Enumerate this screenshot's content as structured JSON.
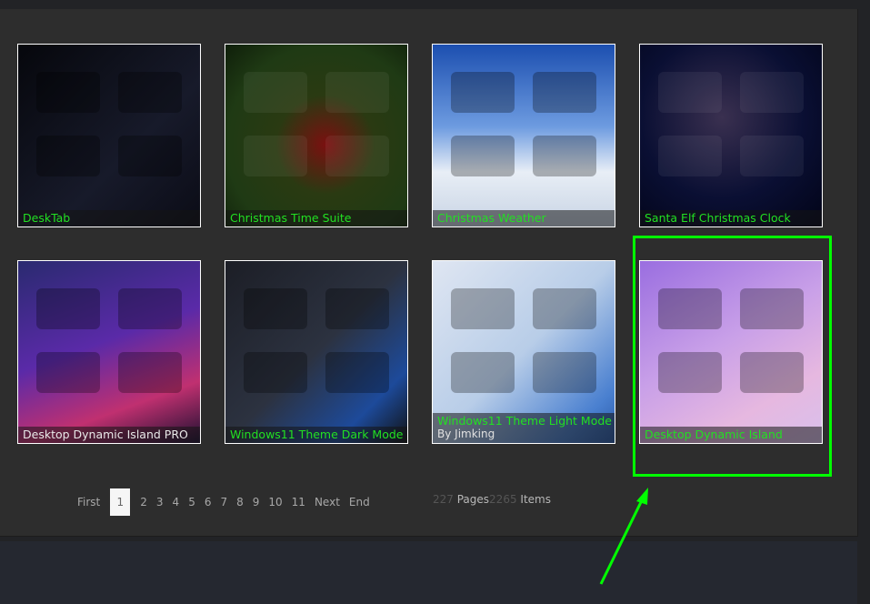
{
  "gallery": [
    {
      "title": "DeskTab",
      "title_color": "green",
      "bg": "linear-gradient(135deg,#06070c,#171a2a 60%,#0b0c16)"
    },
    {
      "title": "Christmas Time Suite",
      "title_color": "green",
      "bg": "radial-gradient(circle at 55% 55%,#7a1010 0,#2a3a12 35%,#1f3a14 70%,#0f1f0a)"
    },
    {
      "title": "Christmas Weather",
      "title_color": "green",
      "bg": "linear-gradient(180deg,#1c4fb0,#6d9be0 45%,#e8eef6 70%,#c8d4e4)"
    },
    {
      "title": "Santa Elf Christmas Clock",
      "title_color": "green",
      "bg": "radial-gradient(circle at 45% 40%,#3a3050 0,#0a0f33 55%,#020418)"
    },
    {
      "title": "Desktop Dynamic Island PRO",
      "title_color": "white",
      "bg": "linear-gradient(160deg,#2a2a70,#5a2aa8 45%,#c03070 75%,#1a1030)"
    },
    {
      "title": "Windows11 Theme Dark Mode",
      "title_color": "green",
      "bg": "linear-gradient(135deg,#1c1e26,#2c3240 50%,#1d4a9a 80%,#111)"
    },
    {
      "title": "Windows11 Theme Light Mode",
      "title_color": "green",
      "subtitle": "By Jimking",
      "bg": "linear-gradient(135deg,#dfe6f2,#b8cde8 50%,#4a80d0 85%,#2a5aa8)"
    },
    {
      "title": "Desktop Dynamic Island",
      "title_color": "green",
      "bg": "linear-gradient(150deg,#9a6ee0,#c9a0e8 45%,#e6b8e0 75%,#d8c0ec)"
    }
  ],
  "pagination": {
    "first": "First",
    "pages": [
      "1",
      "2",
      "3",
      "4",
      "5",
      "6",
      "7",
      "8",
      "9",
      "10",
      "11"
    ],
    "current": "1",
    "next": "Next",
    "end": "End"
  },
  "stats": {
    "pages_count": "227",
    "pages_label": "Pages",
    "items_count": "2265",
    "items_label": "Items"
  },
  "colors": {
    "highlight": "#00ff00",
    "caption_green": "#22e022"
  }
}
